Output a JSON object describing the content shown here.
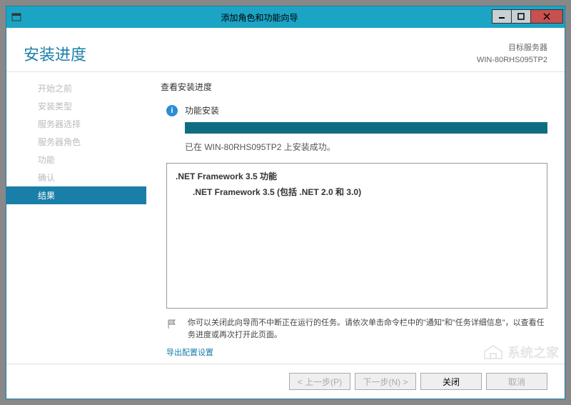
{
  "titlebar": {
    "title": "添加角色和功能向导"
  },
  "header": {
    "page_title": "安装进度",
    "target_label": "目标服务器",
    "target_server": "WIN-80RHS095TP2"
  },
  "sidebar": {
    "items": [
      {
        "label": "开始之前",
        "active": false
      },
      {
        "label": "安装类型",
        "active": false
      },
      {
        "label": "服务器选择",
        "active": false
      },
      {
        "label": "服务器角色",
        "active": false
      },
      {
        "label": "功能",
        "active": false
      },
      {
        "label": "确认",
        "active": false
      },
      {
        "label": "结果",
        "active": true
      }
    ]
  },
  "main": {
    "view_label": "查看安装进度",
    "status_label": "功能安装",
    "success_msg": "已在 WIN-80RHS095TP2 上安装成功。",
    "features": {
      "parent": ".NET Framework 3.5 功能",
      "child": ".NET Framework 3.5 (包括 .NET 2.0 和 3.0)"
    },
    "hint": "你可以关闭此向导而不中断正在运行的任务。请依次单击命令栏中的\"通知\"和\"任务详细信息\"，以查看任务进度或再次打开此页面。",
    "export_link": "导出配置设置"
  },
  "footer": {
    "prev": "< 上一步(P)",
    "next": "下一步(N) >",
    "close": "关闭",
    "cancel": "取消"
  },
  "watermark": "系统之家"
}
